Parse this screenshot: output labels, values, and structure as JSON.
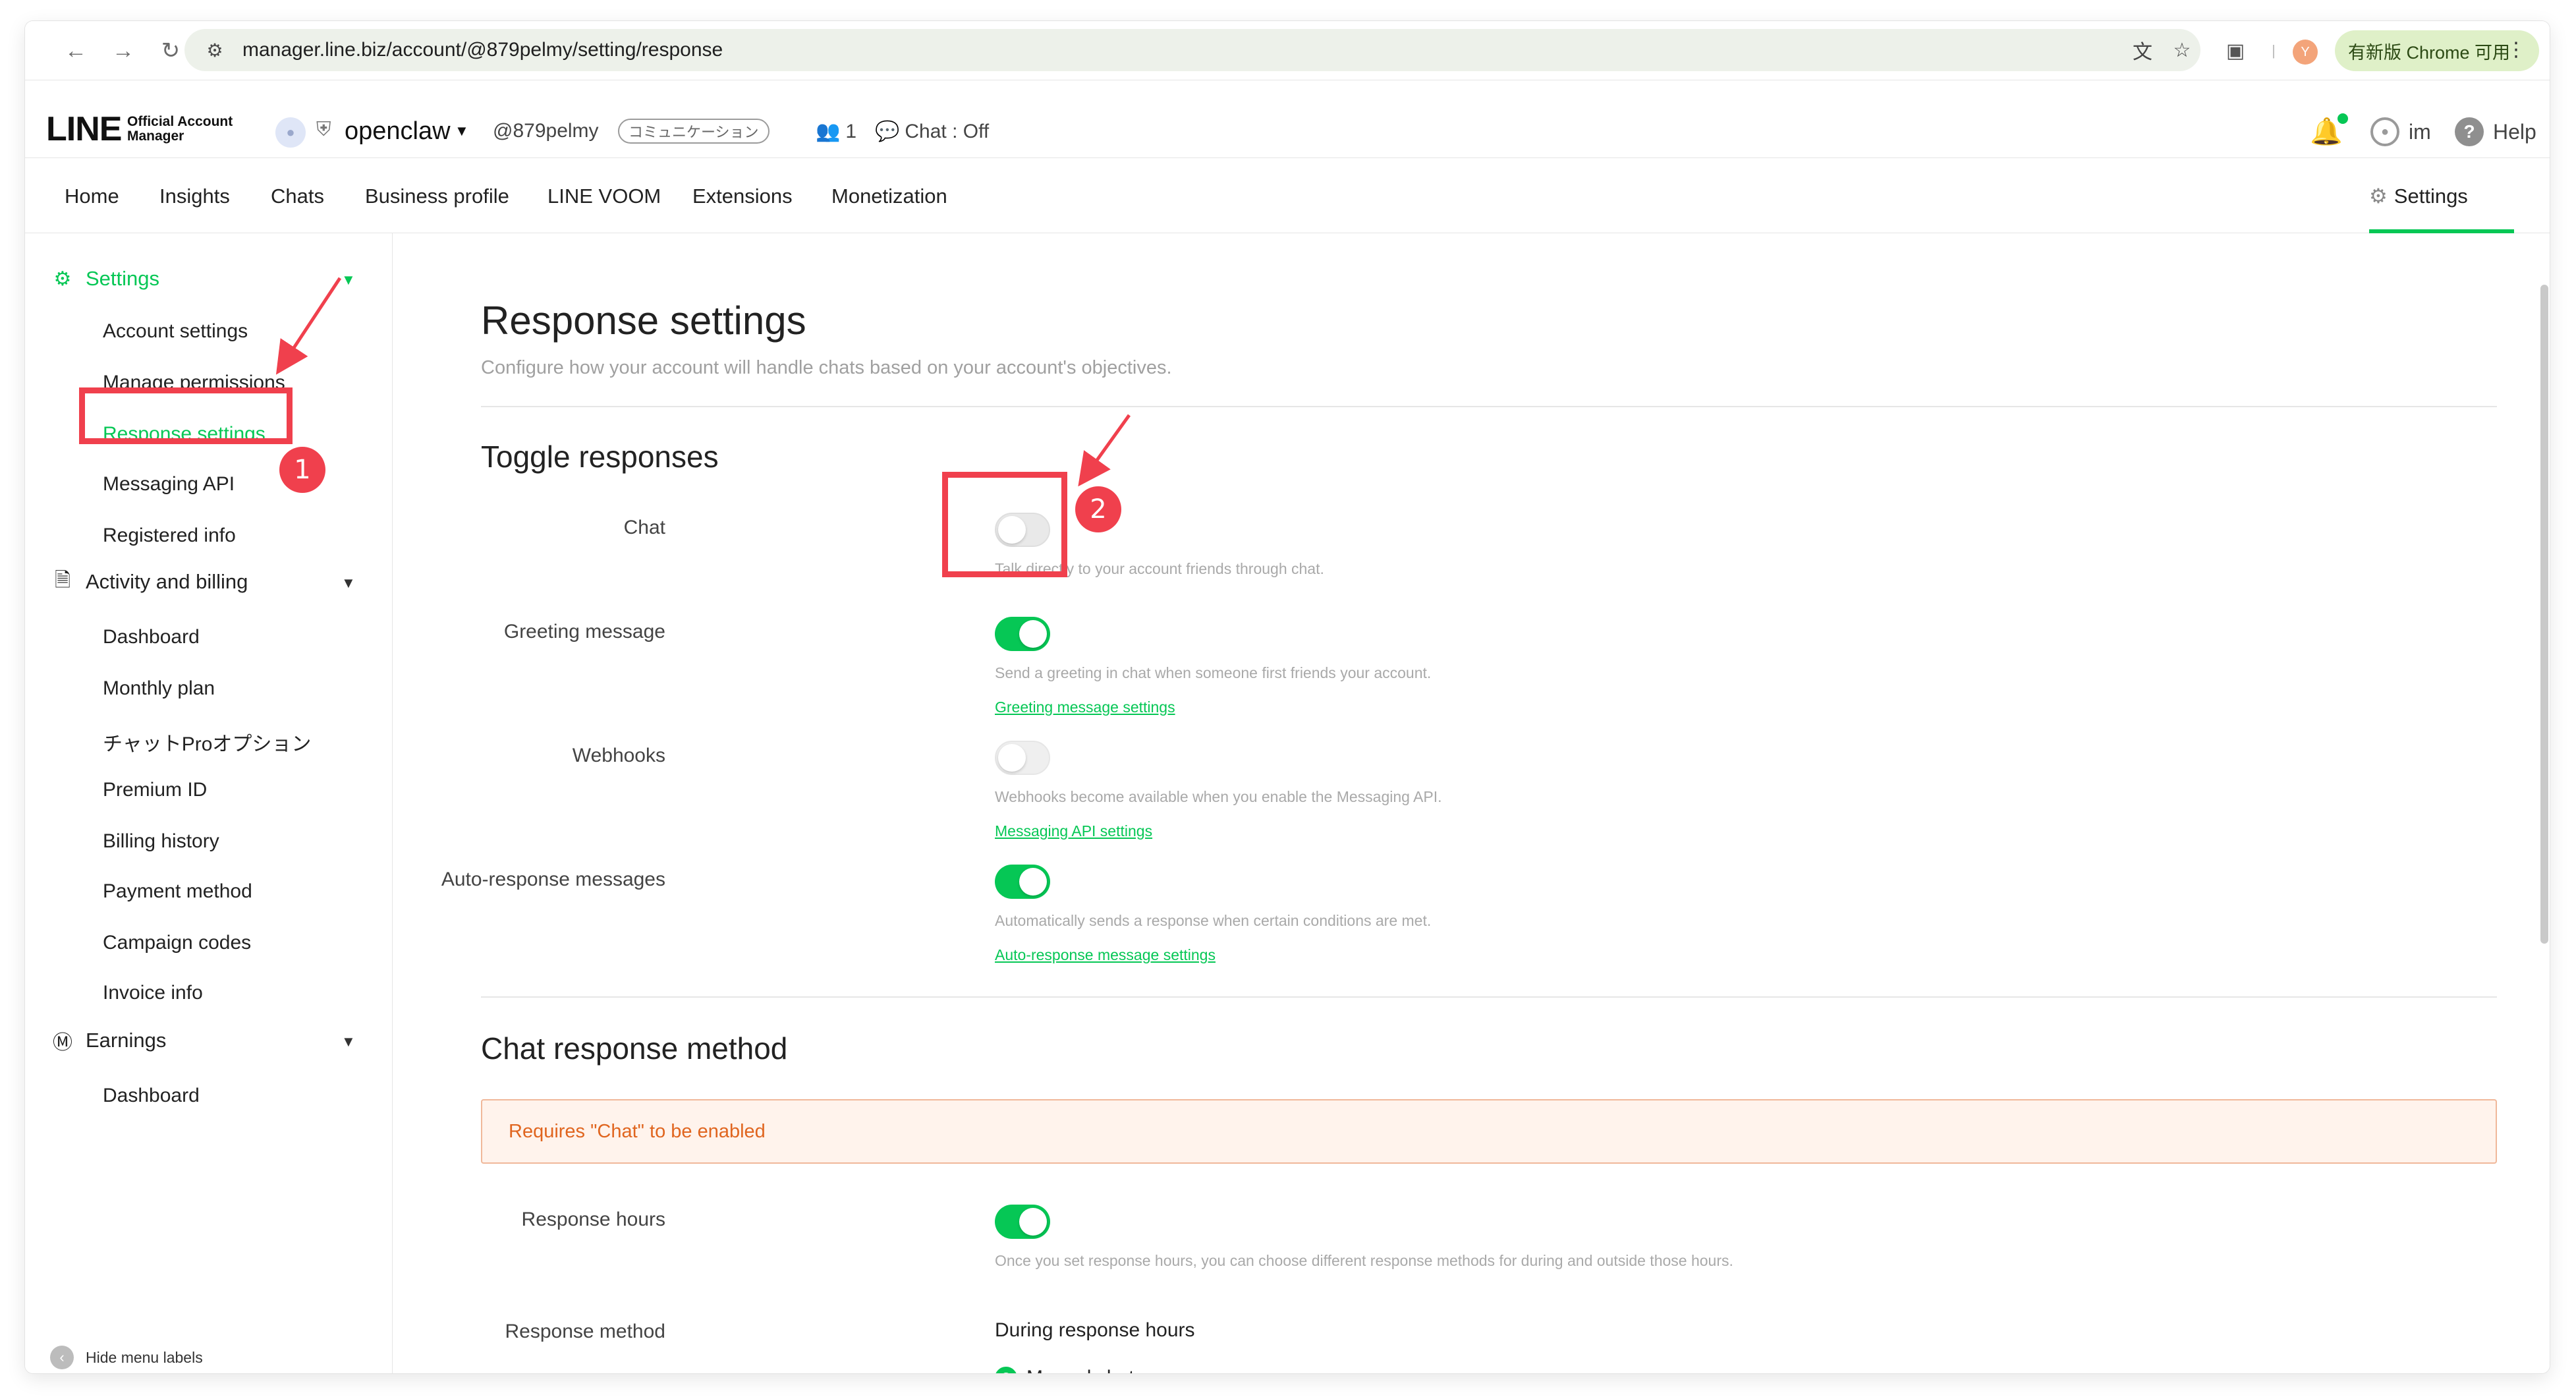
{
  "browser": {
    "url": "manager.line.biz/account/@879pelmy/setting/response",
    "update_label": "有新版 Chrome 可用",
    "profile_initial": "Y"
  },
  "header": {
    "logo_main": "LINE",
    "logo_sub_1": "Official Account",
    "logo_sub_2": "Manager",
    "account_name": "openclaw",
    "account_id": "@879pelmy",
    "account_badge": "コミュニケーション",
    "friends_count": "1",
    "chat_status": "Chat : Off",
    "user_label": "im",
    "help_label": "Help"
  },
  "topnav": {
    "items": [
      "Home",
      "Insights",
      "Chats",
      "Business profile",
      "LINE VOOM",
      "Extensions",
      "Monetization"
    ],
    "settings_label": "Settings"
  },
  "sidebar": {
    "settings_group": "Settings",
    "settings_items": [
      "Account settings",
      "Manage permissions",
      "Response settings",
      "Messaging API",
      "Registered info"
    ],
    "activity_group": "Activity and billing",
    "activity_items": [
      "Dashboard",
      "Monthly plan",
      "チャットProオプション",
      "Premium ID",
      "Billing history",
      "Payment method",
      "Campaign codes",
      "Invoice info"
    ],
    "earnings_group": "Earnings",
    "earnings_items": [
      "Dashboard"
    ],
    "hide_menu": "Hide menu labels"
  },
  "main": {
    "title": "Response settings",
    "subtitle": "Configure how your account will handle chats based on your account's objectives.",
    "toggle_section": "Toggle responses",
    "toggles": [
      {
        "label": "Chat",
        "state": "off",
        "desc": "Talk directly to your account friends through chat.",
        "link": ""
      },
      {
        "label": "Greeting message",
        "state": "on",
        "desc": "Send a greeting in chat when someone first friends your account.",
        "link": "Greeting message settings"
      },
      {
        "label": "Webhooks",
        "state": "disabled",
        "desc": "Webhooks become available when you enable the Messaging API.",
        "link": "Messaging API settings"
      },
      {
        "label": "Auto-response messages",
        "state": "on",
        "desc": "Automatically sends a response when certain conditions are met.",
        "link": "Auto-response message settings"
      }
    ],
    "chat_section": "Chat response method",
    "warning": "Requires \"Chat\" to be enabled",
    "response_hours_label": "Response hours",
    "response_hours_state": "on",
    "response_hours_desc": "Once you set response hours, you can choose different response methods for during and outside those hours.",
    "response_method_label": "Response method",
    "response_method_title": "During response hours",
    "response_method_option": "Manual chat"
  },
  "annotations": {
    "step1": "1",
    "step2": "2",
    "color": "#f0404d"
  },
  "colors": {
    "accent": "#06c755",
    "warning_text": "#e0651f",
    "warning_bg": "#fff3ec"
  }
}
